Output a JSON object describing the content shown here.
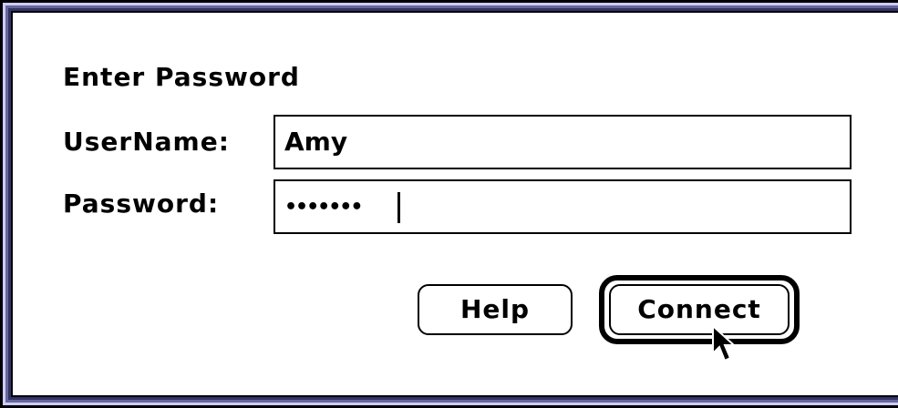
{
  "dialog": {
    "title": "Enter Password",
    "username": {
      "label": "UserName:",
      "value": "Amy"
    },
    "password": {
      "label": "Password:",
      "masked_value": "•••••••",
      "char_count": 7
    },
    "buttons": {
      "help": "Help",
      "connect": "Connect",
      "default": "connect"
    }
  },
  "icons": {
    "pointer": "arrow-cursor-icon"
  },
  "colors": {
    "frame_light": "#ccccff",
    "frame_mid": "#666699",
    "frame_dark": "#333366",
    "background": "#ffffff",
    "ink": "#000000"
  }
}
